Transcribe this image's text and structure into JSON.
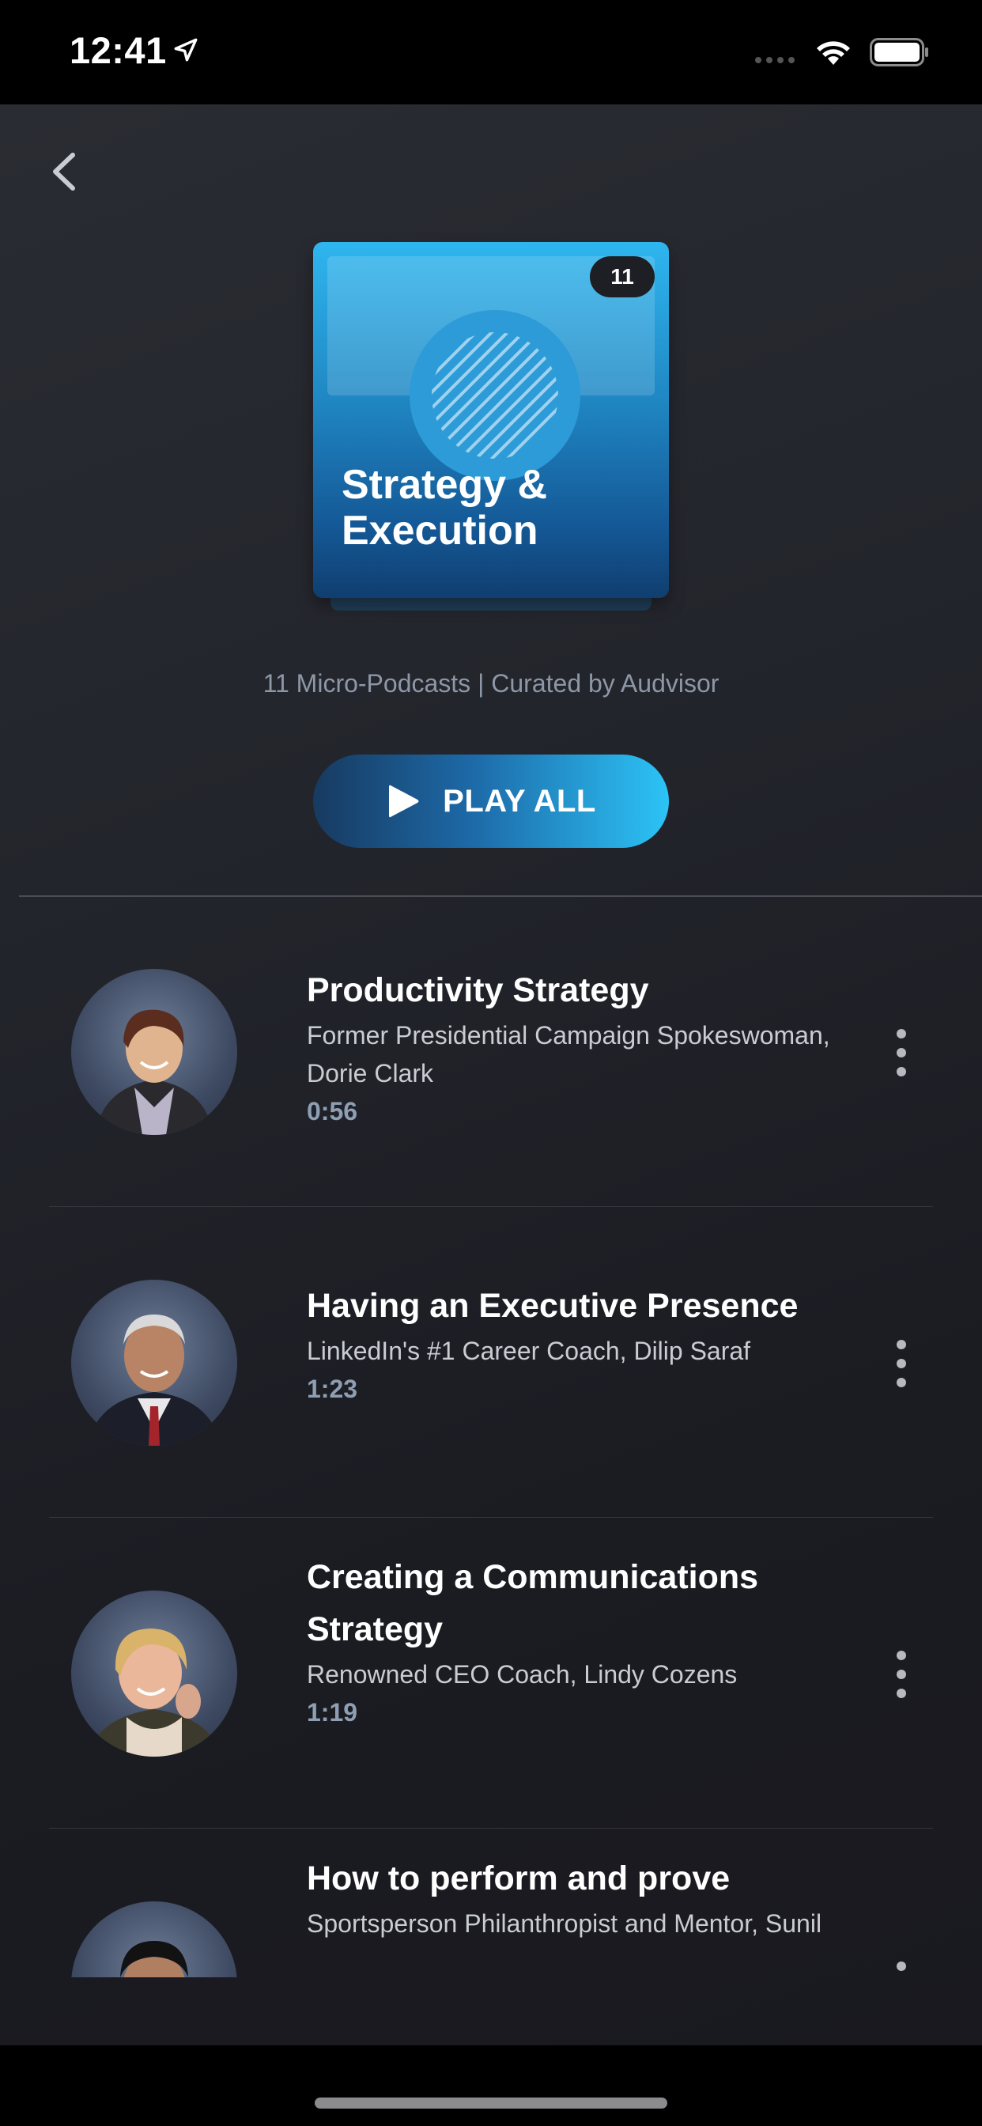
{
  "status_bar": {
    "time": "12:41",
    "icons": [
      "location-arrow-icon",
      "signal-icon",
      "wifi-icon",
      "battery-icon"
    ]
  },
  "nav": {
    "back_icon": "chevron-left-icon"
  },
  "collection": {
    "badge_count": "11",
    "cover_title_line1": "Strategy &",
    "cover_title_line2": "Execution",
    "subtitle": "11 Micro-Podcasts | Curated by Audvisor",
    "accent_color": "#2cc3f6"
  },
  "play_all": {
    "label": "PLAY ALL",
    "icon": "play-icon"
  },
  "items": [
    {
      "title": "Productivity Strategy",
      "author_line1": "Former Presidential Campaign Spokeswoman,",
      "author_line2": "Dorie Clark",
      "duration": "0:56"
    },
    {
      "title": "Having an Executive Presence",
      "author_line1": "LinkedIn's #1 Career Coach,  Dilip Saraf",
      "author_line2": "",
      "duration": "1:23"
    },
    {
      "title_line1": "Creating a Communications",
      "title_line2": "Strategy",
      "author_line1": "Renowned CEO Coach,  Lindy Cozens",
      "duration": "1:19"
    },
    {
      "title": "How to perform and prove",
      "author_line1": "Sportsperson Philanthropist and Mentor,  Sunil"
    }
  ]
}
